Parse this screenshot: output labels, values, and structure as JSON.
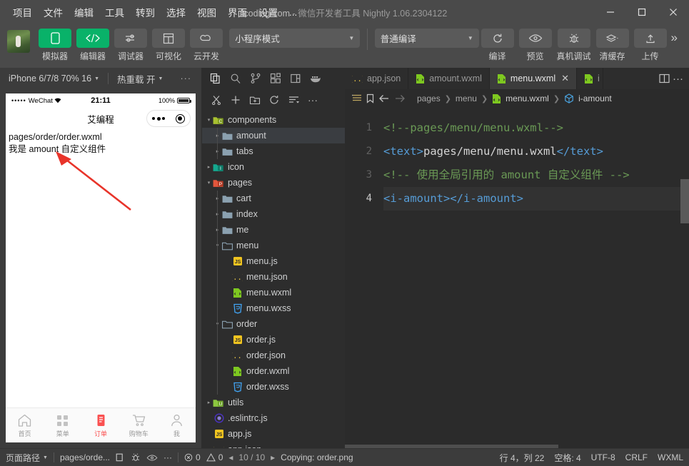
{
  "titlebar": {
    "menus": [
      "项目",
      "文件",
      "编辑",
      "工具",
      "转到",
      "选择",
      "视图",
      "界面",
      "设置",
      "..."
    ],
    "project": "icoding-com",
    "dash": "-",
    "app": "微信开发者工具",
    "version": "Nightly 1.06.2304122",
    "minimize": "—",
    "maximize": "▢",
    "close": "✕"
  },
  "toolbar": {
    "buttons": [
      {
        "label": "模拟器",
        "icon": "phone-icon",
        "style": "green"
      },
      {
        "label": "编辑器",
        "icon": "code-icon",
        "style": "green"
      },
      {
        "label": "调试器",
        "icon": "debugger-icon",
        "style": "plain"
      },
      {
        "label": "可视化",
        "icon": "layout-icon",
        "style": "plain"
      },
      {
        "label": "云开发",
        "icon": "cloud-icon",
        "style": "plain"
      }
    ],
    "mode_select": "小程序模式",
    "compile_select": "普通编译",
    "actions": [
      {
        "label": "编译",
        "icon": "refresh-icon"
      },
      {
        "label": "预览",
        "icon": "eye-icon"
      },
      {
        "label": "真机调试",
        "icon": "bug-icon"
      },
      {
        "label": "清缓存",
        "icon": "layers-icon"
      },
      {
        "label": "上传",
        "icon": "upload-icon"
      }
    ],
    "overflow": "»"
  },
  "simulator": {
    "device": "iPhone 6/7/8 70% 16",
    "hotreload": "热重载 开",
    "more": "···",
    "phone": {
      "signal_dots": "•••••",
      "carrier": "WeChat",
      "wifi": "⌃",
      "time": "21:11",
      "battery": "100%",
      "nav_title": "艾编程",
      "lines": [
        "pages/order/order.wxml",
        "我是 amount 自定义组件"
      ],
      "tabs": [
        {
          "label": "首页",
          "icon": "home-icon",
          "active": false
        },
        {
          "label": "菜单",
          "icon": "grid-icon",
          "active": false
        },
        {
          "label": "订单",
          "icon": "order-icon",
          "active": true
        },
        {
          "label": "购物车",
          "icon": "cart-icon",
          "active": false
        },
        {
          "label": "我",
          "icon": "person-icon",
          "active": false
        }
      ]
    }
  },
  "explorer": {
    "activity_icons": [
      "files-icon",
      "search-icon",
      "source-control-icon",
      "extensions-icon",
      "window-icon",
      "docker-icon"
    ],
    "op_icons": [
      "cut-icon",
      "new-file-icon",
      "new-folder-icon",
      "refresh-icon",
      "collapse-all-icon",
      "more-icon"
    ],
    "tree": [
      {
        "name": "components",
        "type": "folder-components",
        "indent": 0,
        "twisty": "▾",
        "selected": false
      },
      {
        "name": "amount",
        "type": "folder",
        "indent": 1,
        "twisty": "▸",
        "selected": true
      },
      {
        "name": "tabs",
        "type": "folder",
        "indent": 1,
        "twisty": "▸",
        "selected": false
      },
      {
        "name": "icon",
        "type": "folder-icon",
        "indent": 0,
        "twisty": "▸",
        "selected": false
      },
      {
        "name": "pages",
        "type": "folder-pages",
        "indent": 0,
        "twisty": "▾",
        "selected": false
      },
      {
        "name": "cart",
        "type": "folder",
        "indent": 1,
        "twisty": "▸",
        "selected": false
      },
      {
        "name": "index",
        "type": "folder",
        "indent": 1,
        "twisty": "▸",
        "selected": false
      },
      {
        "name": "me",
        "type": "folder",
        "indent": 1,
        "twisty": "▸",
        "selected": false
      },
      {
        "name": "menu",
        "type": "folder-open",
        "indent": 1,
        "twisty": "▾",
        "selected": false
      },
      {
        "name": "menu.js",
        "type": "js",
        "indent": 2,
        "twisty": "",
        "selected": false
      },
      {
        "name": "menu.json",
        "type": "json",
        "indent": 2,
        "twisty": "",
        "selected": false
      },
      {
        "name": "menu.wxml",
        "type": "wxml",
        "indent": 2,
        "twisty": "",
        "selected": false
      },
      {
        "name": "menu.wxss",
        "type": "wxss",
        "indent": 2,
        "twisty": "",
        "selected": false
      },
      {
        "name": "order",
        "type": "folder-open",
        "indent": 1,
        "twisty": "▾",
        "selected": false
      },
      {
        "name": "order.js",
        "type": "js",
        "indent": 2,
        "twisty": "",
        "selected": false
      },
      {
        "name": "order.json",
        "type": "json",
        "indent": 2,
        "twisty": "",
        "selected": false
      },
      {
        "name": "order.wxml",
        "type": "wxml",
        "indent": 2,
        "twisty": "",
        "selected": false
      },
      {
        "name": "order.wxss",
        "type": "wxss",
        "indent": 2,
        "twisty": "",
        "selected": false
      },
      {
        "name": "utils",
        "type": "folder-utils",
        "indent": 0,
        "twisty": "▸",
        "selected": false
      },
      {
        "name": ".eslintrc.js",
        "type": "eslint",
        "indent": 0,
        "twisty": "",
        "selected": false
      },
      {
        "name": "app.js",
        "type": "js",
        "indent": 0,
        "twisty": "",
        "selected": false
      },
      {
        "name": "app.json",
        "type": "json",
        "indent": 0,
        "twisty": "",
        "selected": false
      }
    ]
  },
  "editor": {
    "tabs": [
      {
        "label": "app.json",
        "icon": "json-icon",
        "active": false,
        "close": ""
      },
      {
        "label": "amount.wxml",
        "icon": "wxml-icon",
        "active": false,
        "close": ""
      },
      {
        "label": "menu.wxml",
        "icon": "wxml-icon",
        "active": true,
        "close": "✕"
      },
      {
        "label": "i",
        "icon": "wxml-icon",
        "active": false,
        "close": ""
      }
    ],
    "tab_actions": [
      "split-editor-icon",
      "more-icon"
    ],
    "breadcrumb": {
      "icons": [
        "outline-icon",
        "bookmark-icon",
        "back-icon",
        "forward-icon"
      ],
      "segments": [
        "pages",
        "menu",
        "menu.wxml",
        "i-amount"
      ]
    },
    "gutter": [
      "1",
      "2",
      "3",
      "4"
    ],
    "code": [
      {
        "n": 1,
        "parts": [
          {
            "t": "<!--pages/menu/menu.wxml-->",
            "c": "cmt"
          }
        ]
      },
      {
        "n": 2,
        "parts": [
          {
            "t": "<text>",
            "c": "tagb"
          },
          {
            "t": "pages/menu/menu.wxml",
            "c": "txt"
          },
          {
            "t": "</text>",
            "c": "tagb"
          }
        ]
      },
      {
        "n": 3,
        "parts": [
          {
            "t": "<!-- 使用全局引用的 amount 自定义组件 -->",
            "c": "cmt"
          }
        ]
      },
      {
        "n": 4,
        "parts": [
          {
            "t": "<i-amount>",
            "c": "tagb"
          },
          {
            "t": "</i-amount>",
            "c": "tagb"
          }
        ]
      }
    ]
  },
  "status": {
    "page_path_label": "页面路径",
    "path": "pages/orde...",
    "left_icons": [
      "copy-icon",
      "bug-icon",
      "eye-icon",
      "more-icon"
    ],
    "errors": "0",
    "warnings": "0",
    "nav_prev": "◂",
    "nav_count": "10 / 10",
    "nav_next": "▸",
    "message": "Copying: order.png",
    "cursor": "行 4，列 22",
    "indent": "空格: 4",
    "encoding": "UTF-8",
    "eol": "CRLF",
    "language": "WXML"
  },
  "colors": {
    "accent_green": "#09b269",
    "active_red": "#fa5151",
    "comment_green": "#6a9955",
    "tag_blue": "#569cd6",
    "bg": "#2b2b2b"
  }
}
